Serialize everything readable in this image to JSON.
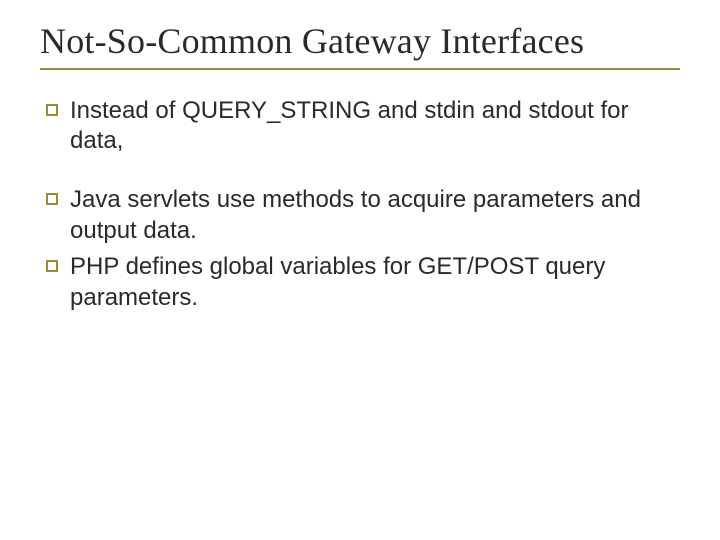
{
  "slide": {
    "title": "Not-So-Common Gateway Interfaces",
    "bullets": [
      {
        "text": "Instead of QUERY_STRING and stdin and stdout for data,"
      },
      {
        "text": "Java servlets use methods to acquire parameters and output data."
      },
      {
        "text": "PHP defines global variables for GET/POST query parameters."
      }
    ]
  }
}
